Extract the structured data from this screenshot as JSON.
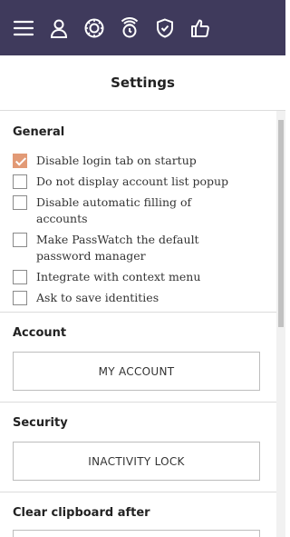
{
  "topbar": {
    "icons": [
      "menu-icon",
      "user-icon",
      "vault-icon",
      "watch-icon",
      "shield-icon",
      "thumbs-up-icon"
    ],
    "background": "#3f3a5c"
  },
  "header": {
    "title": "Settings"
  },
  "general": {
    "title": "General",
    "options": [
      {
        "label": "Disable login tab on startup",
        "checked": true
      },
      {
        "label": "Do not display account list popup",
        "checked": false
      },
      {
        "label": "Disable automatic filling of accounts",
        "checked": false
      },
      {
        "label": "Make PassWatch the default password manager",
        "checked": false
      },
      {
        "label": "Integrate with context menu",
        "checked": false
      },
      {
        "label": "Ask to save identities",
        "checked": false
      }
    ]
  },
  "account": {
    "title": "Account",
    "button_label": "MY ACCOUNT"
  },
  "security": {
    "title": "Security",
    "button_label": "INACTIVITY LOCK"
  },
  "clipboard": {
    "title": "Clear clipboard after"
  },
  "colors": {
    "accent": "#e29a76",
    "border": "#bdbdbd"
  }
}
